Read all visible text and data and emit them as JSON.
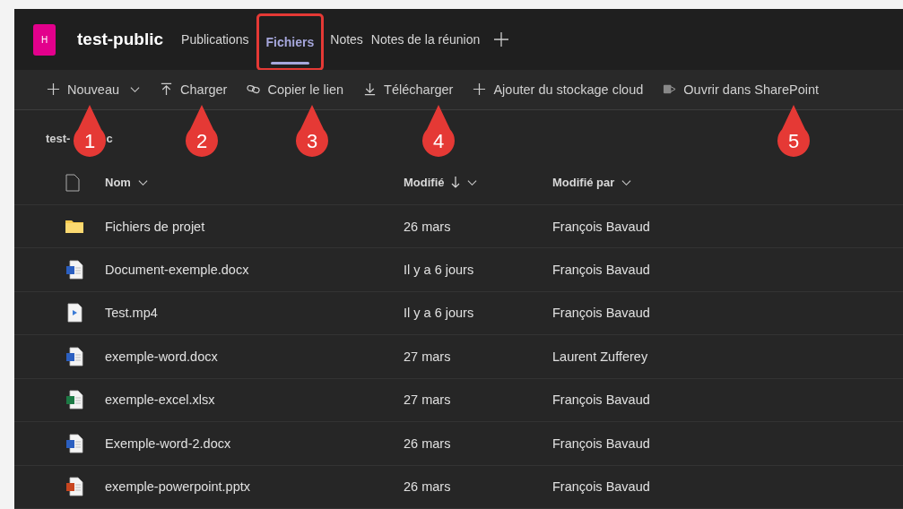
{
  "team": {
    "avatar": "H",
    "name": "test-public"
  },
  "tabs": [
    {
      "label": "Publications",
      "selected": false
    },
    {
      "label": "Fichiers",
      "selected": true
    },
    {
      "label": "Notes",
      "selected": false
    },
    {
      "label": "Notes de la réunion",
      "selected": false
    }
  ],
  "toolbar": [
    {
      "label": "Nouveau",
      "kind": "plus",
      "dropdown": true
    },
    {
      "label": "Charger",
      "kind": "upload",
      "dropdown": false
    },
    {
      "label": "Copier le lien",
      "kind": "link",
      "dropdown": false
    },
    {
      "label": "Télécharger",
      "kind": "download",
      "dropdown": false
    },
    {
      "label": "Ajouter du stockage cloud",
      "kind": "plus",
      "dropdown": false
    },
    {
      "label": "Ouvrir dans SharePoint",
      "kind": "sharepoint",
      "dropdown": false
    }
  ],
  "breadcrumb": {
    "before_callout": "test-",
    "after_callout": "c"
  },
  "table": {
    "columns": [
      {
        "label": "Nom",
        "sorted": false
      },
      {
        "label": "Modifié",
        "sorted": true
      },
      {
        "label": "Modifié par",
        "sorted": false
      }
    ],
    "rows": [
      {
        "kind": "folder",
        "name": "Fichiers de projet",
        "modified": "26 mars",
        "modified_by": "François Bavaud"
      },
      {
        "kind": "word",
        "name": "Document-exemple.docx",
        "modified": "Il y a 6 jours",
        "modified_by": "François Bavaud"
      },
      {
        "kind": "video",
        "name": "Test.mp4",
        "modified": "Il y a 6 jours",
        "modified_by": "François Bavaud"
      },
      {
        "kind": "word",
        "name": "exemple-word.docx",
        "modified": "27 mars",
        "modified_by": "Laurent Zufferey"
      },
      {
        "kind": "excel",
        "name": "exemple-excel.xlsx",
        "modified": "27 mars",
        "modified_by": "François Bavaud"
      },
      {
        "kind": "word",
        "name": "Exemple-word-2.docx",
        "modified": "26 mars",
        "modified_by": "François Bavaud"
      },
      {
        "kind": "powerpoint",
        "name": "exemple-powerpoint.pptx",
        "modified": "26 mars",
        "modified_by": "François Bavaud"
      }
    ]
  },
  "callouts": [
    "1",
    "2",
    "3",
    "4",
    "5"
  ]
}
